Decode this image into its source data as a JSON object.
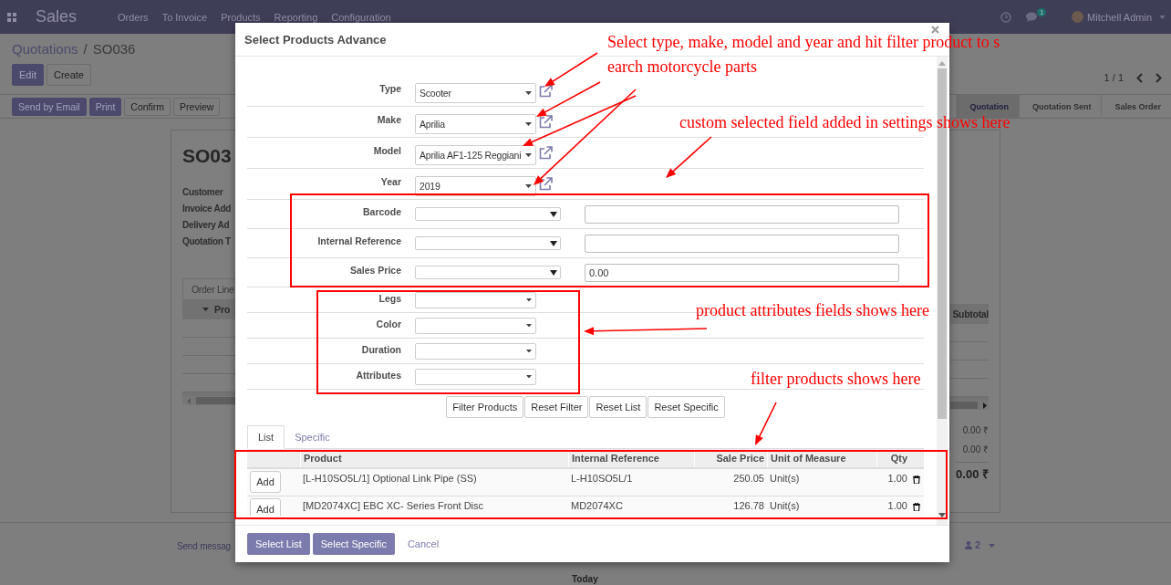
{
  "navbar": {
    "app": "Sales",
    "menu": [
      "Orders",
      "To Invoice",
      "Products",
      "Reporting",
      "Configuration"
    ],
    "chat_count": "1",
    "user": "Mitchell Admin"
  },
  "breadcrumb": {
    "parent": "Quotations",
    "separator": "/",
    "current": "SO036"
  },
  "actions": [
    {
      "label": "Edit",
      "kind": "primary"
    },
    {
      "label": "Create",
      "kind": "secondary"
    }
  ],
  "pager": "1 / 1",
  "toolbar": [
    {
      "label": "Send by Email",
      "kind": "primary"
    },
    {
      "label": "Print",
      "kind": "primary"
    },
    {
      "label": "Confirm",
      "kind": "secondary"
    },
    {
      "label": "Preview",
      "kind": "secondary"
    }
  ],
  "stages": [
    {
      "label": "Quotation",
      "selected": true
    },
    {
      "label": "Quotation Sent",
      "selected": false
    },
    {
      "label": "Sales Order",
      "selected": false
    }
  ],
  "sheet": {
    "title": "SO03",
    "labels": [
      "Customer",
      "Invoice Add",
      "Delivery Ad",
      "Quotation T"
    ],
    "tab": "Order Line",
    "first_column": "Pro",
    "last_column": "Subtotal",
    "totals": [
      "0.00 ₹",
      "0.00 ₹",
      "0.00 ₹"
    ]
  },
  "chatter": {
    "send": "Send messag",
    "followers": "2",
    "day": "Today"
  },
  "dialog": {
    "title": "Select Products Advance",
    "vehicle_fields": [
      {
        "label": "Type",
        "value": "Scooter"
      },
      {
        "label": "Make",
        "value": "Aprilia"
      },
      {
        "label": "Model",
        "value": "Aprilia AF1-125 Reggiani"
      },
      {
        "label": "Year",
        "value": "2019"
      }
    ],
    "custom_fields": [
      {
        "label": "Barcode"
      },
      {
        "label": "Internal Reference"
      },
      {
        "label": "Sales Price",
        "value": "0.00"
      }
    ],
    "attribute_fields": [
      {
        "label": "Legs"
      },
      {
        "label": "Color"
      },
      {
        "label": "Duration"
      },
      {
        "label": "Attributes"
      }
    ],
    "filter_buttons": [
      "Filter Products",
      "Reset Filter",
      "Reset List",
      "Reset Specific"
    ],
    "tabs": [
      {
        "label": "List",
        "selected": true
      },
      {
        "label": "Specific",
        "selected": false
      }
    ],
    "table": {
      "columns": [
        "Product",
        "Internal Reference",
        "Sale Price",
        "Unit of Measure",
        "Qty"
      ],
      "rows": [
        {
          "add": "Add",
          "product": "[L-H10SO5L/1] Optional Link Pipe (SS)",
          "reference": "L-H10SO5L/1",
          "price": "250.05",
          "uom": "Unit(s)",
          "qty": "1.00"
        },
        {
          "add": "Add",
          "product": "[MD2074XC] EBC XC- Series Front Disc",
          "reference": "MD2074XC",
          "price": "126.78",
          "uom": "Unit(s)",
          "qty": "1.00"
        }
      ]
    },
    "footer": [
      {
        "label": "Select List",
        "kind": "primary"
      },
      {
        "label": "Select Specific",
        "kind": "primary"
      },
      {
        "label": "Cancel",
        "kind": "link"
      }
    ]
  },
  "annotations": [
    {
      "lines": [
        "Select type, make, model and year and hit filter product to s",
        "earch motorcycle parts"
      ]
    },
    {
      "lines": [
        "custom selected field added in settings shows here"
      ]
    },
    {
      "lines": [
        "product attributes fields shows here"
      ]
    },
    {
      "lines": [
        "filter products shows here"
      ]
    }
  ]
}
